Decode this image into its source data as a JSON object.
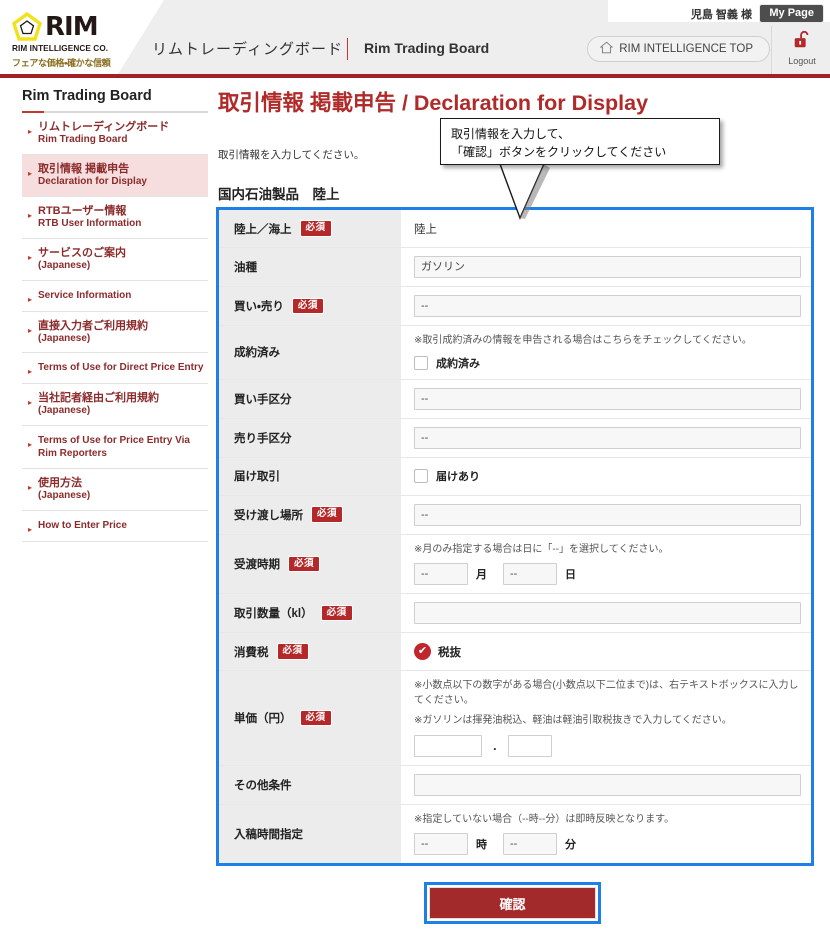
{
  "header": {
    "logo_word": "RIM",
    "logo_sub1": "RIM INTELLIGENCE CO.",
    "logo_sub2": "フェアな価格・確かな信頼",
    "nav_title_ja": "リムトレーディングボード",
    "nav_title_en": "Rim Trading Board",
    "user_name": "児島 智義 様",
    "mypage_label": "My Page",
    "top_button_label": "RIM INTELLIGENCE TOP",
    "logout_label": "Logout"
  },
  "sidebar": {
    "title": "Rim Trading Board",
    "items": [
      {
        "ja": "リムトレーディングボード",
        "en": "Rim Trading Board",
        "active": false
      },
      {
        "ja": "取引情報 掲載申告",
        "en": "Declaration for Display",
        "active": true
      },
      {
        "ja": "RTBユーザー情報",
        "en": "RTB User Information",
        "active": false
      },
      {
        "ja": "サービスのご案内",
        "en": "(Japanese)",
        "active": false
      },
      {
        "ja": "",
        "en": "Service Information",
        "active": false
      },
      {
        "ja": "直接入力者ご利用規約",
        "en": "(Japanese)",
        "active": false
      },
      {
        "ja": "",
        "en": "Terms of Use for Direct Price Entry",
        "active": false
      },
      {
        "ja": "当社記者経由ご利用規約",
        "en": "(Japanese)",
        "active": false
      },
      {
        "ja": "",
        "en": "Terms of Use for Price Entry Via Rim Reporters",
        "active": false
      },
      {
        "ja": "使用方法",
        "en": "(Japanese)",
        "active": false
      },
      {
        "ja": "",
        "en": "How to Enter Price",
        "active": false
      }
    ]
  },
  "main": {
    "page_title": "取引情報 掲載申告 / Declaration for Display",
    "intro": "取引情報を入力してください。",
    "section_heading": "国内石油製品　陸上",
    "callout_line1": "取引情報を入力して、",
    "callout_line2": "「確認」ボタンをクリックしてください",
    "submit_label": "確認"
  },
  "form": {
    "rows": [
      {
        "label": "陸上／海上",
        "required": true,
        "type": "text",
        "value": "陸上"
      },
      {
        "label": "油種",
        "required": false,
        "type": "select",
        "value": "ガソリン"
      },
      {
        "label": "買い・売り",
        "required": true,
        "type": "select",
        "value": "--"
      },
      {
        "label": "成約済み",
        "required": false,
        "type": "checkbox",
        "note": "※取引成約済みの情報を申告される場合はこちらをチェックしてください。",
        "checkbox_label": "成約済み",
        "checked": false
      },
      {
        "label": "買い手区分",
        "required": false,
        "type": "select",
        "value": "--"
      },
      {
        "label": "売り手区分",
        "required": false,
        "type": "select",
        "value": "--"
      },
      {
        "label": "届け取引",
        "required": false,
        "type": "checkbox",
        "note": "",
        "checkbox_label": "届けあり",
        "checked": false
      },
      {
        "label": "受け渡し場所",
        "required": true,
        "type": "select",
        "value": "--"
      },
      {
        "label": "受渡時期",
        "required": true,
        "type": "month_day",
        "note": "※月のみ指定する場合は日に「--」を選択してください。",
        "month_value": "--",
        "month_unit": "月",
        "day_value": "--",
        "day_unit": "日"
      },
      {
        "label": "取引数量（kl）",
        "required": true,
        "type": "input",
        "value": ""
      },
      {
        "label": "消費税",
        "required": true,
        "type": "radio_checked",
        "value": "税抜"
      },
      {
        "label": "単価（円）",
        "required": true,
        "type": "price",
        "note1": "※小数点以下の数字がある場合(小数点以下二位まで)は、右テキストボックスに入力してください。",
        "note2": "※ガソリンは揮発油税込、軽油は軽油引取税抜きで入力してください。",
        "int_value": "",
        "dec_value": "",
        "separator": "."
      },
      {
        "label": "その他条件",
        "required": false,
        "type": "input",
        "value": ""
      },
      {
        "label": "入稿時間指定",
        "required": false,
        "type": "hour_min",
        "note": "※指定していない場合（--時--分）は即時反映となります。",
        "hour_value": "--",
        "hour_unit": "時",
        "min_value": "--",
        "min_unit": "分"
      }
    ]
  },
  "colors": {
    "brand_red": "#a32126",
    "accent_blue": "#1f7fe8",
    "required_badge": "#b4282a",
    "label_bg": "#ececec",
    "sidebar_active": "#f7dede"
  }
}
